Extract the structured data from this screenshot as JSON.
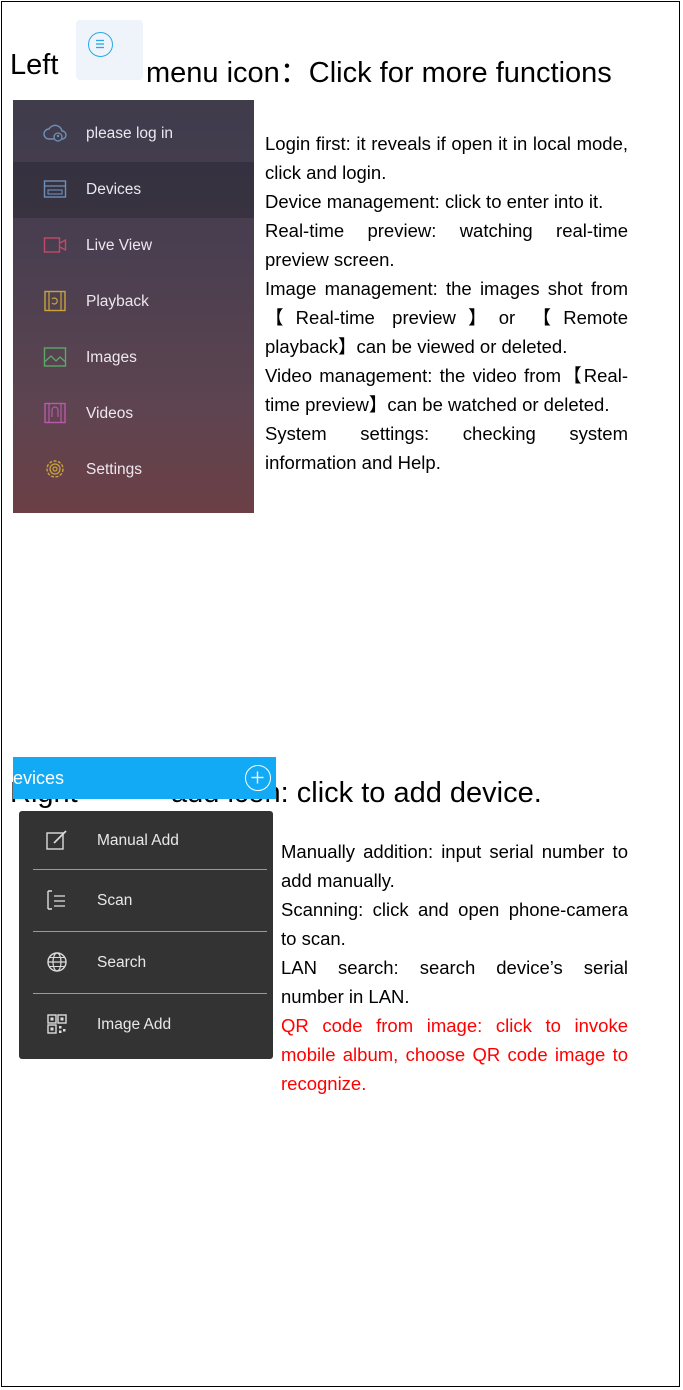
{
  "left_section": {
    "heading_prefix": "Left",
    "heading_suffix": "menu icon：Click for more functions",
    "menu_items": [
      {
        "label": "please log in",
        "icon": "cloud-user-icon"
      },
      {
        "label": "Devices",
        "icon": "device-list-icon"
      },
      {
        "label": "Live View",
        "icon": "video-camera-icon"
      },
      {
        "label": "Playback",
        "icon": "playback-film-icon"
      },
      {
        "label": "Images",
        "icon": "image-icon"
      },
      {
        "label": "Videos",
        "icon": "video-file-icon"
      },
      {
        "label": "Settings",
        "icon": "gear-icon"
      }
    ],
    "descriptions": [
      "Login first: it reveals if open it in local mode, click and login.",
      "Device management: click to enter into it.",
      "Real-time preview: watching real-time preview screen.",
      "Image management: the images shot from【Real-time preview】or 【Remote playback】can be viewed or deleted.",
      "Video management: the video from【Real-time preview】can be watched or deleted.",
      "System settings: checking system information and Help."
    ]
  },
  "right_section": {
    "heading_prefix": "Right",
    "heading_suffix": "add icon: click to add device.",
    "bar_title": "evices",
    "menu_items": [
      {
        "label": "Manual Add",
        "icon": "edit-icon"
      },
      {
        "label": "Scan",
        "icon": "scan-icon"
      },
      {
        "label": "Search",
        "icon": "globe-icon"
      },
      {
        "label": "Image Add",
        "icon": "qr-code-icon"
      }
    ],
    "descriptions": [
      "Manually addition: input serial number to add manually.",
      "Scanning: click and open phone-camera to scan.",
      "LAN search: search device’s serial number in LAN."
    ],
    "highlight_description": "QR code from image: click to invoke mobile album, choose QR code image to recognize.",
    "highlight_color": "#ff0000"
  },
  "colors": {
    "accent": "#13aaf5",
    "icon_blue": "#29a8ea",
    "popup_bg": "#333333"
  }
}
